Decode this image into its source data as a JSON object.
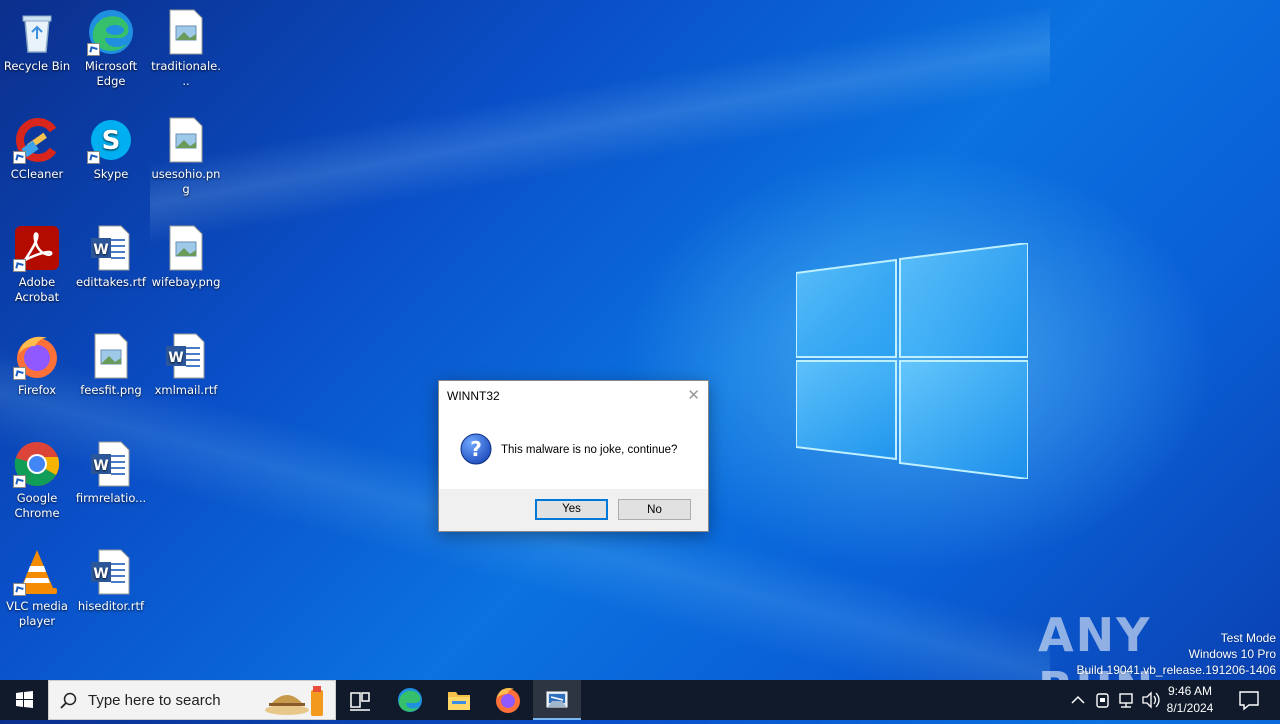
{
  "desktop": {
    "icons": [
      {
        "label": "Recycle Bin"
      },
      {
        "label": "Microsoft Edge"
      },
      {
        "label": "traditionale..."
      },
      {
        "label": "CCleaner"
      },
      {
        "label": "Skype"
      },
      {
        "label": "usesohio.png"
      },
      {
        "label": "Adobe Acrobat"
      },
      {
        "label": "edittakes.rtf"
      },
      {
        "label": "wifebay.png"
      },
      {
        "label": "Firefox"
      },
      {
        "label": "feesfit.png"
      },
      {
        "label": "xmlmail.rtf"
      },
      {
        "label": "Google Chrome"
      },
      {
        "label": "firmrelatio..."
      },
      {
        "label": "VLC media player"
      },
      {
        "label": "hiseditor.rtf"
      }
    ]
  },
  "dialog": {
    "title": "WINNT32",
    "message": "This malware is no joke, continue?",
    "yes_label": "Yes",
    "no_label": "No"
  },
  "watermark": {
    "line1": "Test Mode",
    "line2": "Windows 10 Pro",
    "line3": "Build 19041.vb_release.191206-1406",
    "brand": "ANY RUN"
  },
  "taskbar": {
    "search_placeholder": "Type here to search",
    "time": "9:46 AM",
    "date": "8/1/2024"
  },
  "colors": {
    "taskbar_bg": "#101a2a",
    "accent": "#0078d7"
  }
}
